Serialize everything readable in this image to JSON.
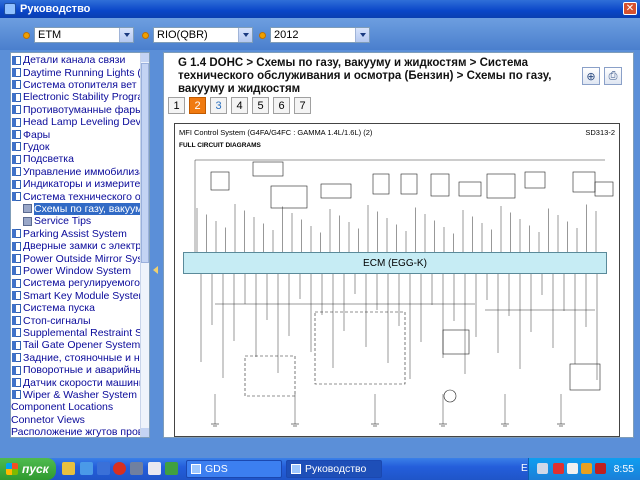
{
  "window": {
    "title": "Руководство"
  },
  "selectors": [
    {
      "value": "ETM"
    },
    {
      "value": "RIO(QBR)"
    },
    {
      "value": "2012"
    }
  ],
  "tree": {
    "items": [
      {
        "label": "Детали канала связи",
        "type": "folder"
      },
      {
        "label": "Daytime Running Lights (DR",
        "type": "folder"
      },
      {
        "label": "Система отопителя вет",
        "type": "folder"
      },
      {
        "label": "Electronic Stability Program",
        "type": "folder"
      },
      {
        "label": "Противотуманные фары",
        "type": "folder"
      },
      {
        "label": "Head Lamp Leveling Device",
        "type": "folder"
      },
      {
        "label": "Фары",
        "type": "folder"
      },
      {
        "label": "Гудок",
        "type": "folder"
      },
      {
        "label": "Подсветка",
        "type": "folder"
      },
      {
        "label": "Управление иммобилизат",
        "type": "folder"
      },
      {
        "label": "Индикаторы и измерители",
        "type": "folder"
      },
      {
        "label": "Система технического обс",
        "type": "folder"
      },
      {
        "label": "Схемы по газу, вакуум",
        "type": "sub",
        "selected": true
      },
      {
        "label": "Service Tips",
        "type": "sub"
      },
      {
        "label": "Parking Assist System",
        "type": "folder"
      },
      {
        "label": "Дверные замки с электро",
        "type": "folder"
      },
      {
        "label": "Power Outside Mirror Syster",
        "type": "folder"
      },
      {
        "label": "Power Window System",
        "type": "folder"
      },
      {
        "label": "Система регулируемого ст",
        "type": "folder"
      },
      {
        "label": "Smart Key Module System",
        "type": "folder"
      },
      {
        "label": "Система пуска",
        "type": "folder"
      },
      {
        "label": "Стоп-сигналы",
        "type": "folder"
      },
      {
        "label": "Supplemental Restraint Syst",
        "type": "folder"
      },
      {
        "label": "Tail Gate Opener System",
        "type": "folder"
      },
      {
        "label": "Задние, стояночные и ном",
        "type": "folder"
      },
      {
        "label": "Поворотные и аварийные с",
        "type": "folder"
      },
      {
        "label": "Датчик скорости машины",
        "type": "folder"
      },
      {
        "label": "Wiper & Washer System",
        "type": "folder"
      },
      {
        "label": "Component Locations",
        "type": "root"
      },
      {
        "label": "Connetor Views",
        "type": "root"
      },
      {
        "label": "Расположение жгутов провод",
        "type": "root"
      }
    ]
  },
  "content": {
    "breadcrumb": "G 1.4 DOHC > Схемы по газу, вакууму и жидкостям > Система технического обслуживания и осмотра (Бензин) > Схемы по газу, вакууму и жидкостям",
    "zoom_icon": "magnifier-icon",
    "print_icon": "printer-icon",
    "pages": [
      "1",
      "2",
      "3",
      "4",
      "5",
      "6",
      "7"
    ],
    "active_page": "2",
    "diagram": {
      "title": "MFI Control System (G4FA/G4FC : GAMMA 1.4L/1.6L) (2)",
      "code": "SD313-2",
      "subtitle": "FULL CIRCUIT DIAGRAMS",
      "ecm_label": "ECM (EGG-K)"
    }
  },
  "taskbar": {
    "start_label": "пуск",
    "tasks": [
      {
        "label": "GDS"
      },
      {
        "label": "Руководство"
      }
    ],
    "language": "EN",
    "clock": "8:55"
  }
}
